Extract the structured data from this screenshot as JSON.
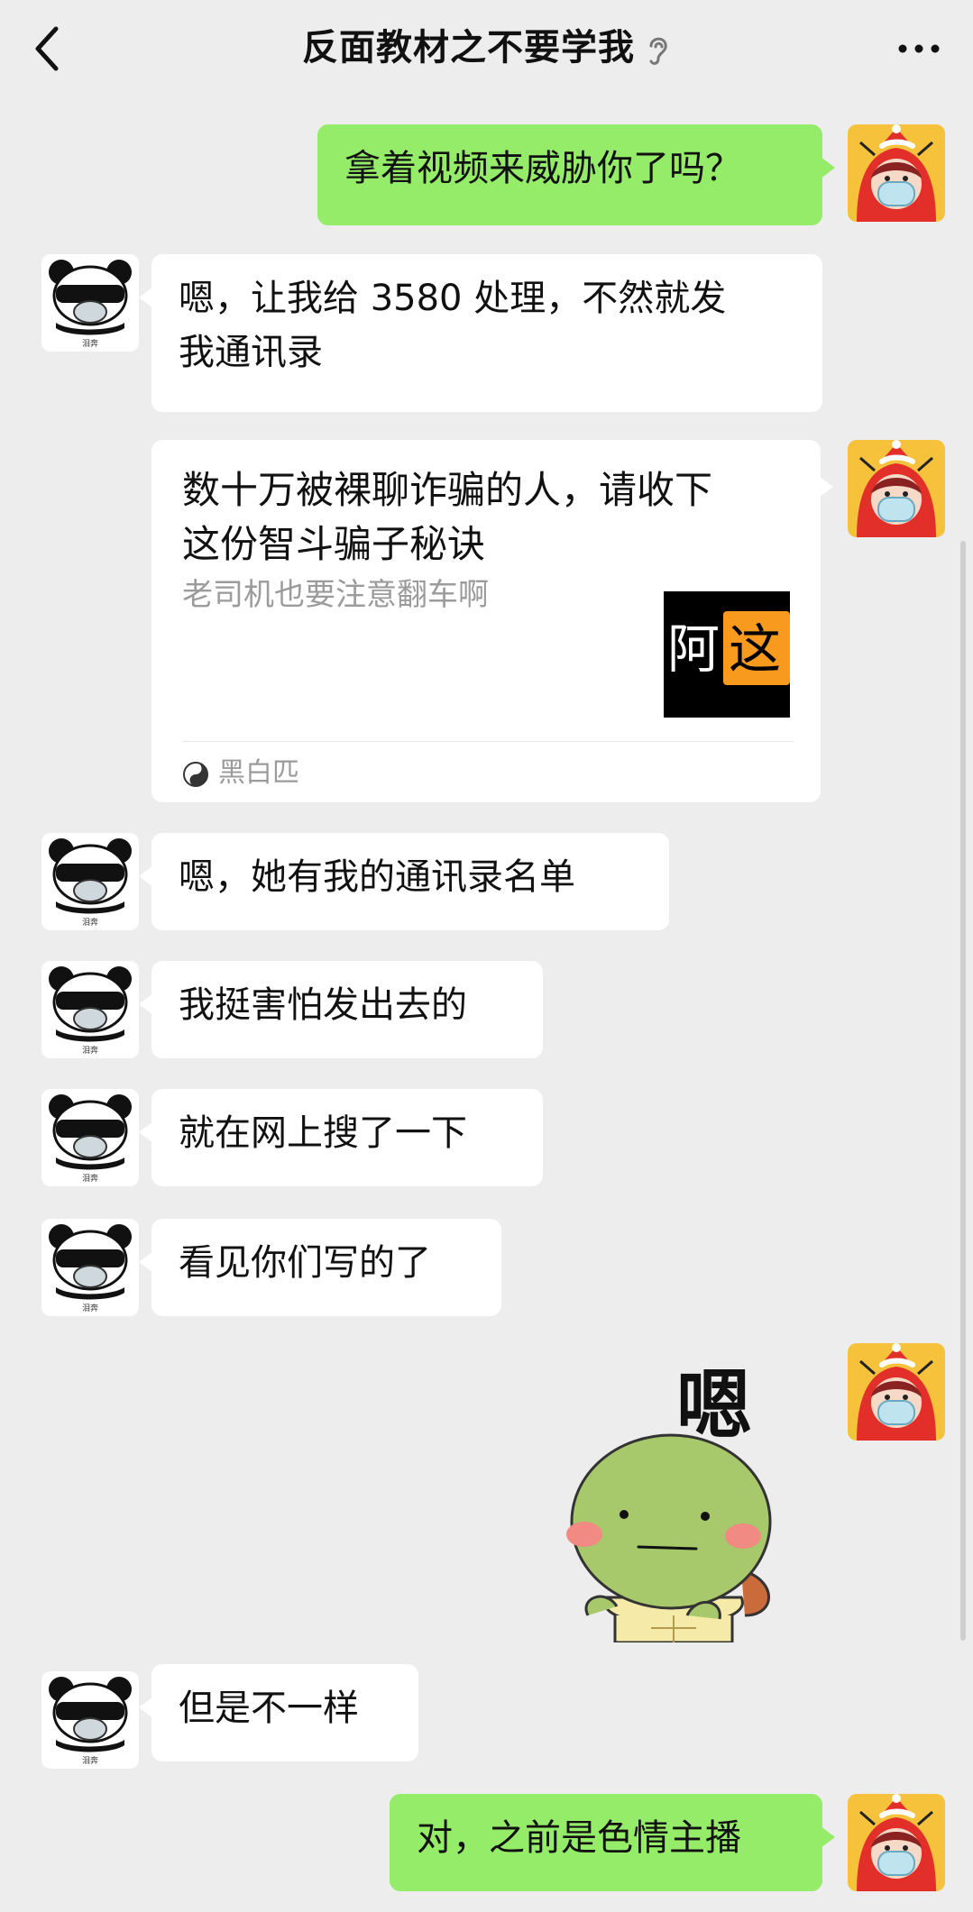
{
  "header": {
    "title": "反面教材之不要学我",
    "back_icon": "chevron-left-icon",
    "ear_icon": "ear-icon",
    "more_icon": "more-dots-icon"
  },
  "messages": [
    {
      "side": "right",
      "type": "text",
      "text": "拿着视频来威胁你了吗？"
    },
    {
      "side": "left",
      "type": "text",
      "lines": [
        "嗯，让我给 3580 处理，不然就发",
        "我通讯录"
      ]
    },
    {
      "side": "right",
      "type": "link-card",
      "title_lines": [
        "数十万被裸聊诈骗的人，请收下",
        "这份智斗骗子秘诀"
      ],
      "description": "老司机也要注意翻车啊",
      "thumbnail_text": [
        "阿",
        "这"
      ],
      "source": "黑白匹"
    },
    {
      "side": "left",
      "type": "text",
      "text": "嗯，她有我的通讯录名单"
    },
    {
      "side": "left",
      "type": "text",
      "text": "我挺害怕发出去的"
    },
    {
      "side": "left",
      "type": "text",
      "text": "就在网上搜了一下"
    },
    {
      "side": "left",
      "type": "text",
      "text": "看见你们写的了"
    },
    {
      "side": "right",
      "type": "sticker",
      "sticker_text": "嗯"
    },
    {
      "side": "left",
      "type": "text",
      "text": "但是不一样"
    },
    {
      "side": "right",
      "type": "text",
      "text": "对，之前是色情主播"
    }
  ],
  "avatars": {
    "self": "red-hooded-character-avatar",
    "other": "panda-meme-avatar",
    "panda_caption": "泪奔"
  },
  "colors": {
    "background": "#ededed",
    "self_bubble": "#95ec69",
    "other_bubble": "#ffffff",
    "secondary_text": "#9b9b9b"
  }
}
